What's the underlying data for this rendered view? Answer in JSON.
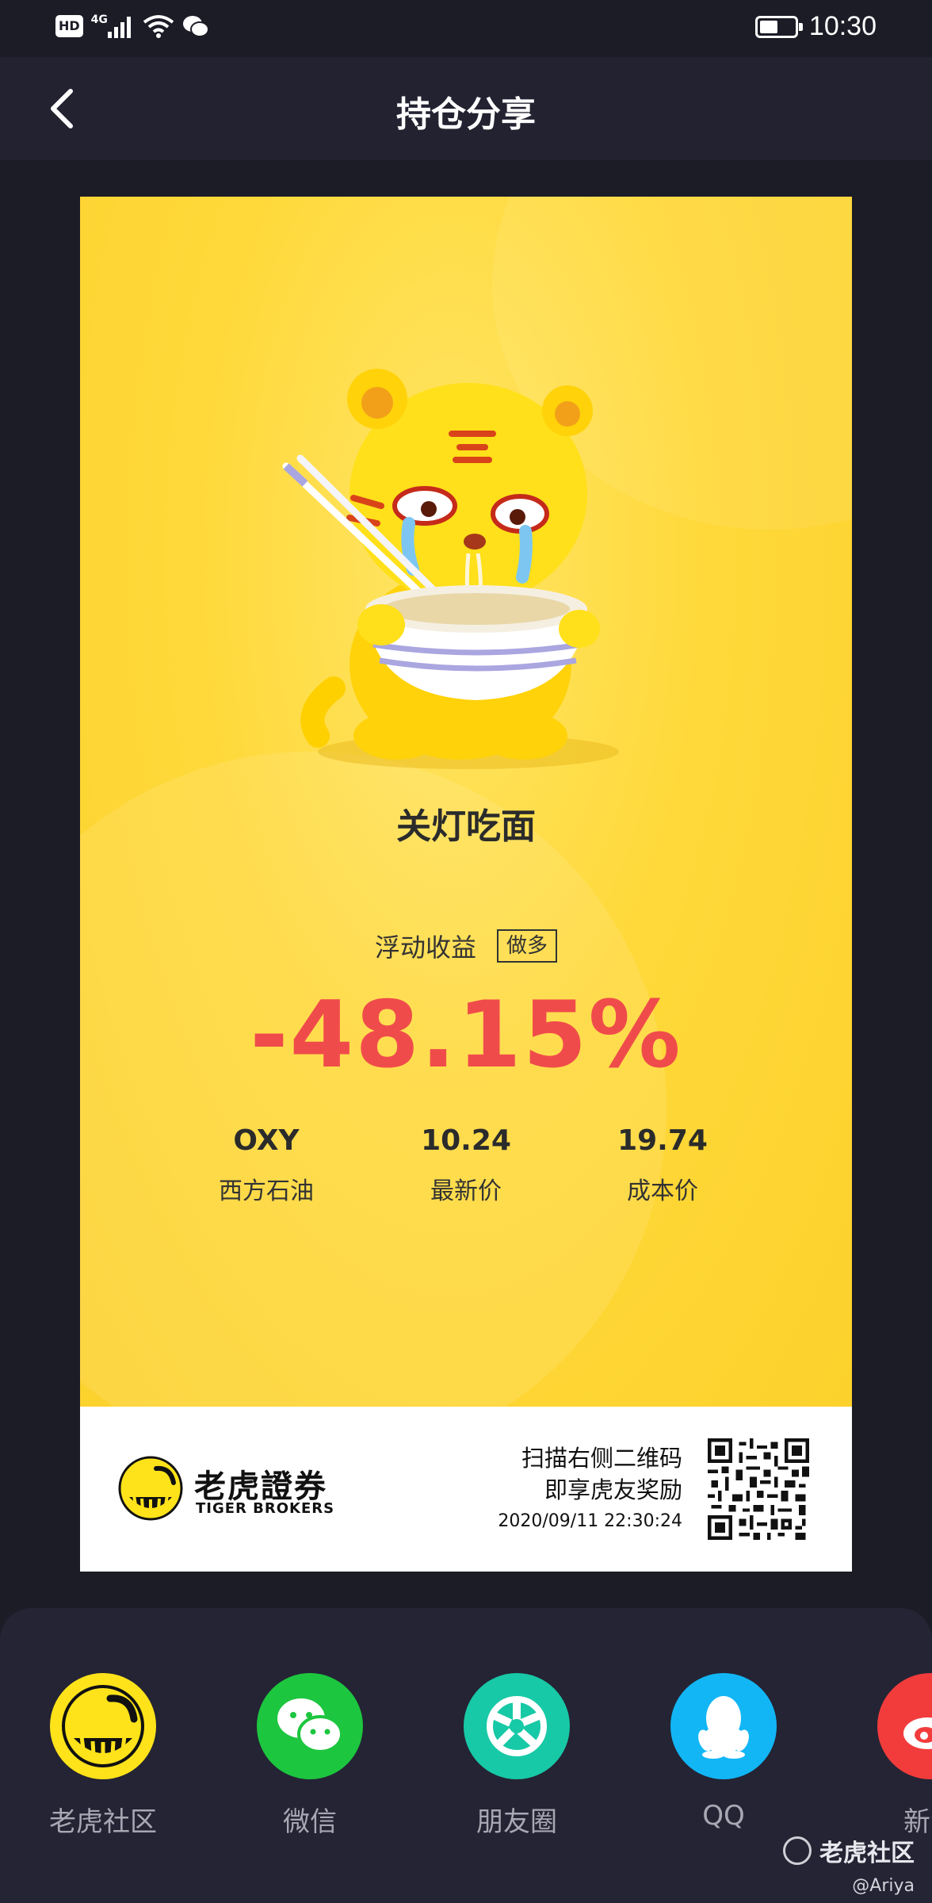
{
  "status_bar": {
    "hd": "HD",
    "network": "4G",
    "time": "10:30"
  },
  "header": {
    "title": "持仓分享"
  },
  "card": {
    "mood": "关灯吃面",
    "profit_label": "浮动收益",
    "direction_tag": "做多",
    "profit_percent": "-48.15%",
    "stats": [
      {
        "value": "OXY",
        "label": "西方石油"
      },
      {
        "value": "10.24",
        "label": "最新价"
      },
      {
        "value": "19.74",
        "label": "成本价"
      }
    ],
    "footer": {
      "brand_cn": "老虎證券",
      "brand_en": "TIGER BROKERS",
      "scan_line1": "扫描右侧二维码",
      "scan_line2": "即享虎友奖励",
      "timestamp": "2020/09/11 22:30:24"
    }
  },
  "share": {
    "items": [
      {
        "label": "老虎社区",
        "icon": "tiger-community-icon",
        "color": "#ffe31a"
      },
      {
        "label": "微信",
        "icon": "wechat-icon",
        "color": "#1dc63f"
      },
      {
        "label": "朋友圈",
        "icon": "moments-icon",
        "color": "#17c9a6"
      },
      {
        "label": "QQ",
        "icon": "qq-icon",
        "color": "#12b6f5"
      },
      {
        "label": "新浪",
        "icon": "weibo-icon",
        "color": "#f23c3c"
      }
    ]
  },
  "watermark": {
    "text": "老虎社区",
    "handle": "@Ariya"
  },
  "colors": {
    "loss_red": "#f04b4b",
    "card_yellow": "#fcd12c",
    "background": "#1c1c27"
  }
}
